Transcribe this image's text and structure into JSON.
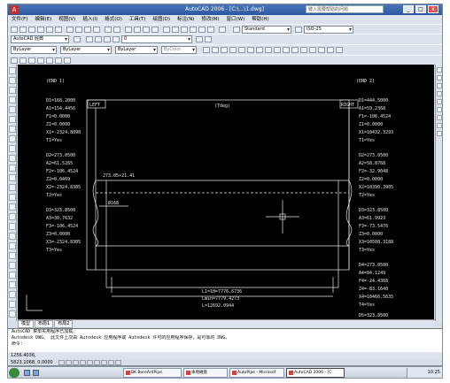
{
  "window": {
    "title": "AutoCAD 2006 - [C:\\...\\1.dwg]",
    "logo_glyph": "A",
    "help_placeholder": "键入需要帮助的问题",
    "min_glyph": "_",
    "max_glyph": "□",
    "close_glyph": "x"
  },
  "menu": [
    "文件(F)",
    "编辑(E)",
    "视图(V)",
    "插入(I)",
    "格式(O)",
    "工具(T)",
    "绘图(D)",
    "标注(N)",
    "修改(M)",
    "窗口(W)",
    "帮助(H)"
  ],
  "toolbars": {
    "workspace_value": "AutoCAD 经典",
    "textstyle_value": "Standard",
    "dimstyle_value": "ISO-25",
    "layer_value": "0",
    "color_value": "ByLayer",
    "linetype_value": "ByLayer",
    "lineweight_value": "ByLayer",
    "plotstyle_value": "ByColor"
  },
  "drawing": {
    "label_left_top": "(END 1)",
    "label_right_top": "(END 2)",
    "tag_left": "LEFT",
    "tag_right": "RIGHT",
    "center_label": "(Tdeg)",
    "left_block_1": [
      "D1=168.2000",
      "A1=154.4456",
      "F1=0.0000",
      "Z1=0.0000",
      "X1=-2324.8098",
      "T1=Yes"
    ],
    "left_block_2": [
      "D2=273.0500",
      "A2=61.5265",
      "F2=-106.4524",
      "Z2=0.0469",
      "X2=-2324.8305",
      "T2=Yes"
    ],
    "left_block_3": [
      "D3=323.8500",
      "A3=30.7632",
      "F3=-106.4524",
      "Z3=0.0000",
      "X3=-2324.8305",
      "T3=Yes"
    ],
    "right_block_1": [
      "D1=444.5000",
      "A1=59.2368",
      "F1=-106.4524",
      "Z1=0.0000",
      "X1=10432.3293",
      "T1=Yes"
    ],
    "right_block_2": [
      "D2=273.0500",
      "A2=58.8768",
      "F2=-32.9048",
      "Z2=0.0000",
      "X2=10390.3905",
      "T2=Yes"
    ],
    "right_block_3": [
      "D3=323.8500",
      "A3=61.9923",
      "F3=-73.5476",
      "Z3=0.0000",
      "X3=10508.3188",
      "T3=Yes"
    ],
    "right_block_4": [
      "D4=273.0500",
      "A4=84.1249",
      "F4=-24.4368",
      "Z4=-83.1640",
      "X4=10466.5635",
      "T4=Yes"
    ],
    "right_block_5": [
      "D5=323.8500"
    ],
    "dim_top": "273.05×21.41",
    "dim_side": "Ø168",
    "length_1": "L1=1H=7776.6736",
    "length_2": "Lmin=7779.4273",
    "length_3": "L=12692.0944"
  },
  "tabs": [
    "模型",
    "布局1",
    "布局2"
  ],
  "command": {
    "line1": "AutoCAD 菜单实用程序已加载。",
    "line2": "Autodesk DWG。 此文件上次由 Autodesk 应用程序或 Autodesk 许可的应用程序保存，是可靠的 DWG。",
    "line3": "命令:"
  },
  "status": {
    "coords": "1256.4036, 5823.1068, 0.0000"
  },
  "taskbar": {
    "tasks": [
      "BK BoreArdPipe",
      "本地磁盘",
      "AutoPipe - Microsof",
      "AutoCAD 2006 - [C"
    ],
    "time": "10:25"
  },
  "colors": {
    "canvas": "#000000",
    "title_bar": "#2b57a0",
    "chrome": "#dce3ec",
    "cad_line": "#e8e8e8",
    "accent_red": "#c03030"
  }
}
